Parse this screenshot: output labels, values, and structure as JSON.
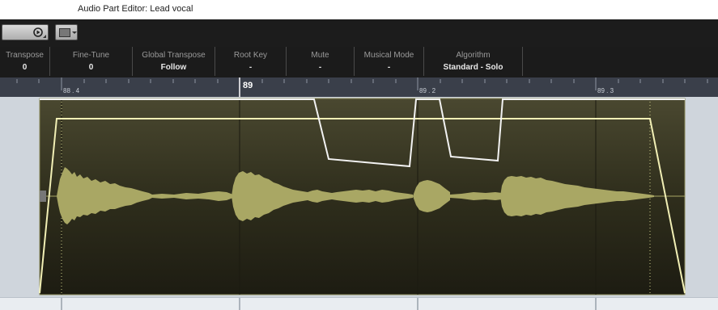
{
  "window": {
    "title": "Audio Part Editor: Lead vocal"
  },
  "toolbar": {
    "play_icon": "play-icon",
    "view_toggle_icon": "frame-icon"
  },
  "infoline": {
    "fields": [
      {
        "label": "Transpose",
        "value": "0"
      },
      {
        "label": "Fine-Tune",
        "value": "0"
      },
      {
        "label": "Global Transpose",
        "value": "Follow"
      },
      {
        "label": "Root Key",
        "value": "-"
      },
      {
        "label": "Mute",
        "value": "-"
      },
      {
        "label": "Musical Mode",
        "value": "-"
      },
      {
        "label": "Algorithm",
        "value": "Standard - Solo"
      }
    ]
  },
  "ruler": {
    "markers": [
      {
        "label": "88 . 4",
        "major": false
      },
      {
        "label": "89",
        "major": true
      },
      {
        "label": "89 . 2",
        "major": false
      },
      {
        "label": "89 . 3",
        "major": false
      }
    ]
  },
  "colors": {
    "waveform": "#a9a764",
    "event_background": "#2f2e1c",
    "envelope_line": "#f1efb5",
    "pitch_curve": "#f2f2f2",
    "ruler_background": "#3a3f4a"
  }
}
